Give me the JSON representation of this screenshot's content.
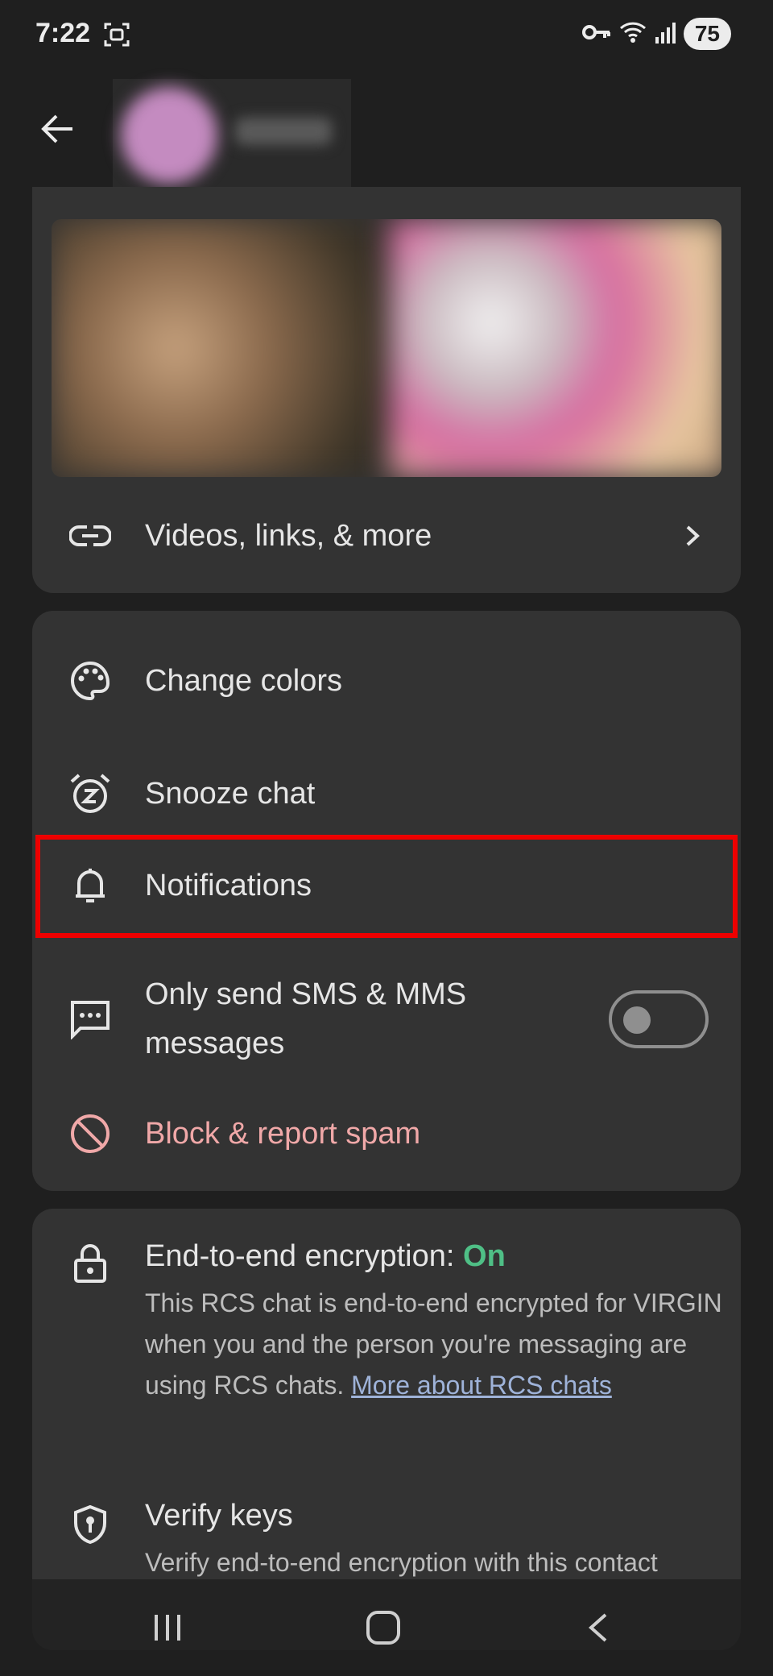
{
  "status_bar": {
    "time": "7:22",
    "battery": "75",
    "icons": [
      "screenshot-icon",
      "vpn-key-icon",
      "wifi-icon",
      "signal-icon",
      "battery-icon"
    ]
  },
  "header": {
    "back_icon": "arrow-left-icon"
  },
  "media_card": {
    "row_label": "Videos, links, & more",
    "icon": "link-icon"
  },
  "settings_card": {
    "items": [
      {
        "label": "Change colors",
        "icon": "palette-icon"
      },
      {
        "label": "Snooze chat",
        "icon": "alarm-snooze-icon"
      },
      {
        "label": "Notifications",
        "icon": "bell-icon"
      },
      {
        "label_line1": "Only send SMS & MMS",
        "label_line2": "messages",
        "icon": "chat-bubble-icon",
        "toggle_on": false
      },
      {
        "label": "Block & report spam",
        "icon": "block-icon"
      }
    ],
    "highlight_color": "#ee0000",
    "spam_color": "#f0a8a8"
  },
  "encryption_card": {
    "title": "End-to-end encryption: ",
    "status": "On",
    "status_color": "#4fbf86",
    "body": "This RCS chat is end-to-end encrypted for VIRGIN when you and the person you're messaging are using RCS chats. ",
    "link": "More about RCS chats",
    "verify_title": "Verify keys",
    "verify_body": "Verify end-to-end encryption with this contact"
  },
  "nav_bar": {
    "icons": [
      "recent-apps-icon",
      "home-icon",
      "back-icon"
    ]
  }
}
